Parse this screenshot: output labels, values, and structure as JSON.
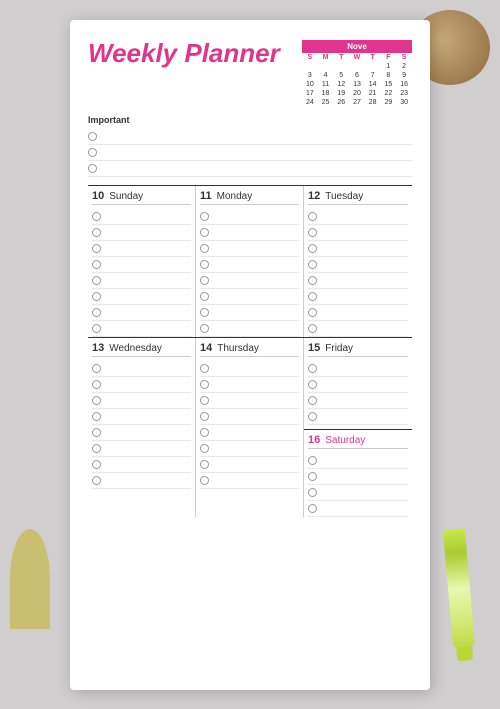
{
  "title": "Weekly Planner",
  "calendar": {
    "month": "November",
    "days_header": [
      "S",
      "M",
      "T",
      "W",
      "T",
      "F",
      "S"
    ],
    "weeks": [
      [
        "",
        "",
        "",
        "",
        "",
        "",
        "1",
        "2"
      ],
      [
        "3",
        "4",
        "5",
        "6",
        "7",
        "8",
        "9"
      ],
      [
        "10",
        "11",
        "12",
        "13",
        "14",
        "15",
        "16"
      ],
      [
        "17",
        "18",
        "19",
        "20",
        "21",
        "22",
        "23"
      ],
      [
        "24",
        "25",
        "26",
        "27",
        "28",
        "29",
        "30"
      ]
    ]
  },
  "important_label": "Important",
  "days": [
    {
      "num": "10",
      "name": "Sunday"
    },
    {
      "num": "11",
      "name": "Monday"
    },
    {
      "num": "12",
      "name": "Tuesday"
    },
    {
      "num": "13",
      "name": "Wednesday"
    },
    {
      "num": "14",
      "name": "Thursday"
    },
    {
      "num": "15",
      "name": "Friday"
    },
    {
      "num": "16",
      "name": "Saturday",
      "pink": true
    }
  ],
  "task_rows_important": 3,
  "task_rows_day": 8,
  "task_rows_saturday": 4
}
